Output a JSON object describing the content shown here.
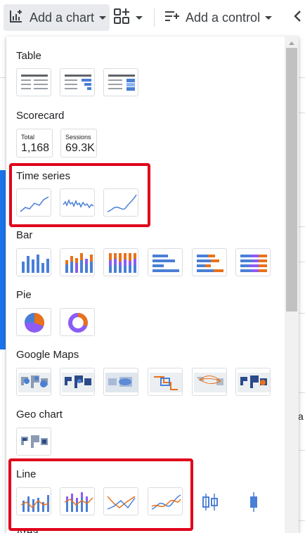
{
  "toolbar": {
    "add_chart_label": "Add a chart",
    "add_control_label": "Add a control"
  },
  "menu": {
    "sections": {
      "table": "Table",
      "scorecard": "Scorecard",
      "time_series": "Time series",
      "bar": "Bar",
      "pie": "Pie",
      "google_maps": "Google Maps",
      "geo_chart": "Geo chart",
      "line": "Line",
      "area": "Area"
    },
    "scorecards": [
      {
        "label": "Total",
        "value": "1,168"
      },
      {
        "label": "Sessions",
        "value": "69.3K"
      }
    ]
  },
  "colors": {
    "blue": "#4a7fd6",
    "purple": "#8b5cf6",
    "orange": "#e8711a",
    "highlight": "#e0001b"
  }
}
